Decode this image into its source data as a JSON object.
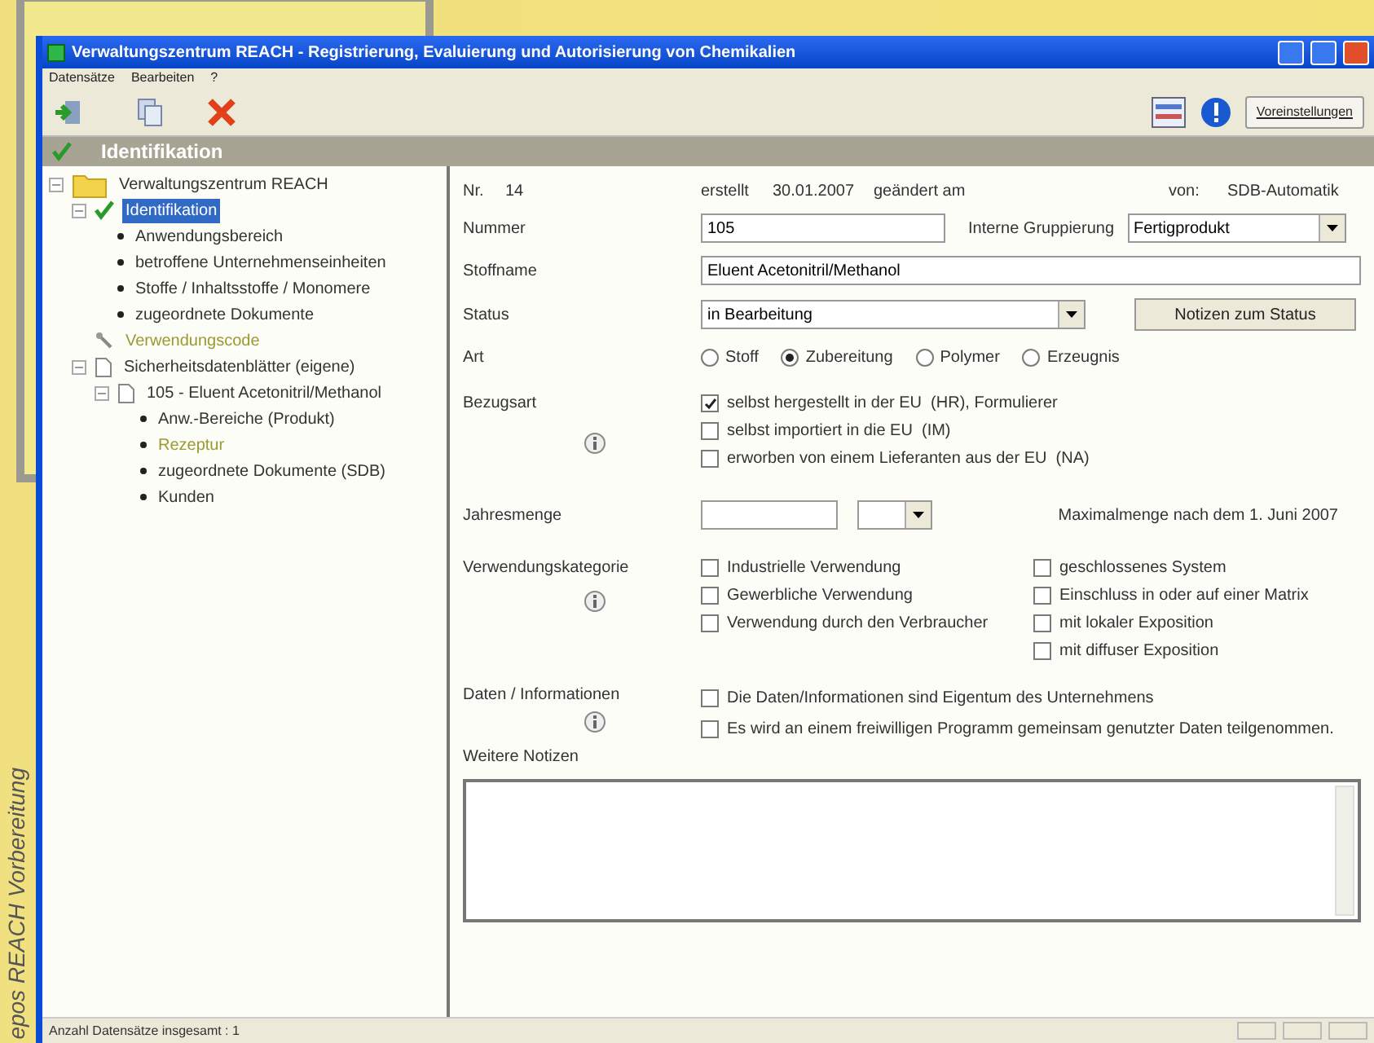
{
  "side_caption": "epos REACH Vorbereitung",
  "window": {
    "title": "Verwaltungszentrum REACH - Registrierung, Evaluierung und Autorisierung von Chemikalien"
  },
  "menu": [
    "Datensätze",
    "Bearbeiten",
    "?"
  ],
  "toolbar": {
    "settings_button": "Voreinstellungen"
  },
  "section_header": "Identifikation",
  "tree": [
    {
      "label": "Verwaltungszentrum REACH",
      "kind": "folder",
      "selected": false,
      "inactive": false,
      "expanded": true,
      "children": [
        {
          "label": "Identifikation",
          "kind": "check",
          "selected": true,
          "inactive": false,
          "expanded": true,
          "children": [
            {
              "label": "Anwendungsbereich",
              "kind": "bullet",
              "selected": false,
              "inactive": false
            },
            {
              "label": "betroffene Unternehmenseinheiten",
              "kind": "bullet",
              "selected": false,
              "inactive": false
            },
            {
              "label": "Stoffe / Inhaltsstoffe / Monomere",
              "kind": "bullet",
              "selected": false,
              "inactive": false
            },
            {
              "label": "zugeordnete Dokumente",
              "kind": "bullet",
              "selected": false,
              "inactive": false
            }
          ]
        },
        {
          "label": "Verwendungscode",
          "kind": "tool",
          "selected": false,
          "inactive": true
        },
        {
          "label": "Sicherheitsdatenblätter (eigene)",
          "kind": "doc",
          "selected": false,
          "inactive": false,
          "expanded": true,
          "children": [
            {
              "label": "105 - Eluent Acetonitril/Methanol",
              "kind": "doc",
              "selected": false,
              "inactive": false,
              "expanded": true,
              "children": [
                {
                  "label": "Anw.-Bereiche (Produkt)",
                  "kind": "bullet",
                  "selected": false,
                  "inactive": false
                },
                {
                  "label": "Rezeptur",
                  "kind": "bullet",
                  "selected": false,
                  "inactive": true
                },
                {
                  "label": "zugeordnete Dokumente (SDB)",
                  "kind": "bullet",
                  "selected": false,
                  "inactive": false
                },
                {
                  "label": "Kunden",
                  "kind": "bullet",
                  "selected": false,
                  "inactive": false
                }
              ]
            }
          ]
        }
      ]
    }
  ],
  "form": {
    "info": {
      "nr_label": "Nr.",
      "nr": "14",
      "created_label": "erstellt",
      "created": "30.01.2007",
      "changed_label": "geändert am",
      "by_label": "von:",
      "by": "SDB-Automatik"
    },
    "nummer": {
      "label": "Nummer",
      "value": "105"
    },
    "gruppierung": {
      "label": "Interne Gruppierung",
      "value": "Fertigprodukt"
    },
    "stoffname": {
      "label": "Stoffname",
      "value": "Eluent Acetonitril/Methanol"
    },
    "status": {
      "label": "Status",
      "value": "in Bearbeitung",
      "button": "Notizen zum Status"
    },
    "art": {
      "label": "Art",
      "options": [
        {
          "label": "Stoff",
          "selected": false
        },
        {
          "label": "Zubereitung",
          "selected": true
        },
        {
          "label": "Polymer",
          "selected": false
        },
        {
          "label": "Erzeugnis",
          "selected": false
        }
      ]
    },
    "bezugsart": {
      "label": "Bezugsart",
      "options": [
        {
          "label": "selbst hergestellt in der EU  (HR), Formulierer",
          "checked": true
        },
        {
          "label": "selbst importiert in die EU  (IM)",
          "checked": false
        },
        {
          "label": "erworben von einem Lieferanten aus der EU  (NA)",
          "checked": false
        }
      ]
    },
    "jahresmenge": {
      "label": "Jahresmenge",
      "note": "Maximalmenge nach dem 1. Juni 2007"
    },
    "verwendung": {
      "label": "Verwendungskategorie",
      "left": [
        {
          "label": "Industrielle Verwendung",
          "checked": false
        },
        {
          "label": "Gewerbliche Verwendung",
          "checked": false
        },
        {
          "label": "Verwendung durch den Verbraucher",
          "checked": false
        }
      ],
      "right": [
        {
          "label": "geschlossenes System",
          "checked": false
        },
        {
          "label": "Einschluss in oder auf einer Matrix",
          "checked": false
        },
        {
          "label": "mit lokaler Exposition",
          "checked": false
        },
        {
          "label": "mit diffuser Exposition",
          "checked": false
        }
      ]
    },
    "daten": {
      "label": "Daten / Informationen",
      "options": [
        {
          "label": "Die Daten/Informationen sind Eigentum des Unternehmens",
          "checked": false
        },
        {
          "label": "Es wird an einem freiwilligen Programm gemeinsam genutzter Daten teilgenommen.",
          "checked": false
        }
      ]
    },
    "notizen": {
      "label": "Weitere Notizen"
    }
  },
  "status_bar": "Anzahl Datensätze insgesamt : 1"
}
